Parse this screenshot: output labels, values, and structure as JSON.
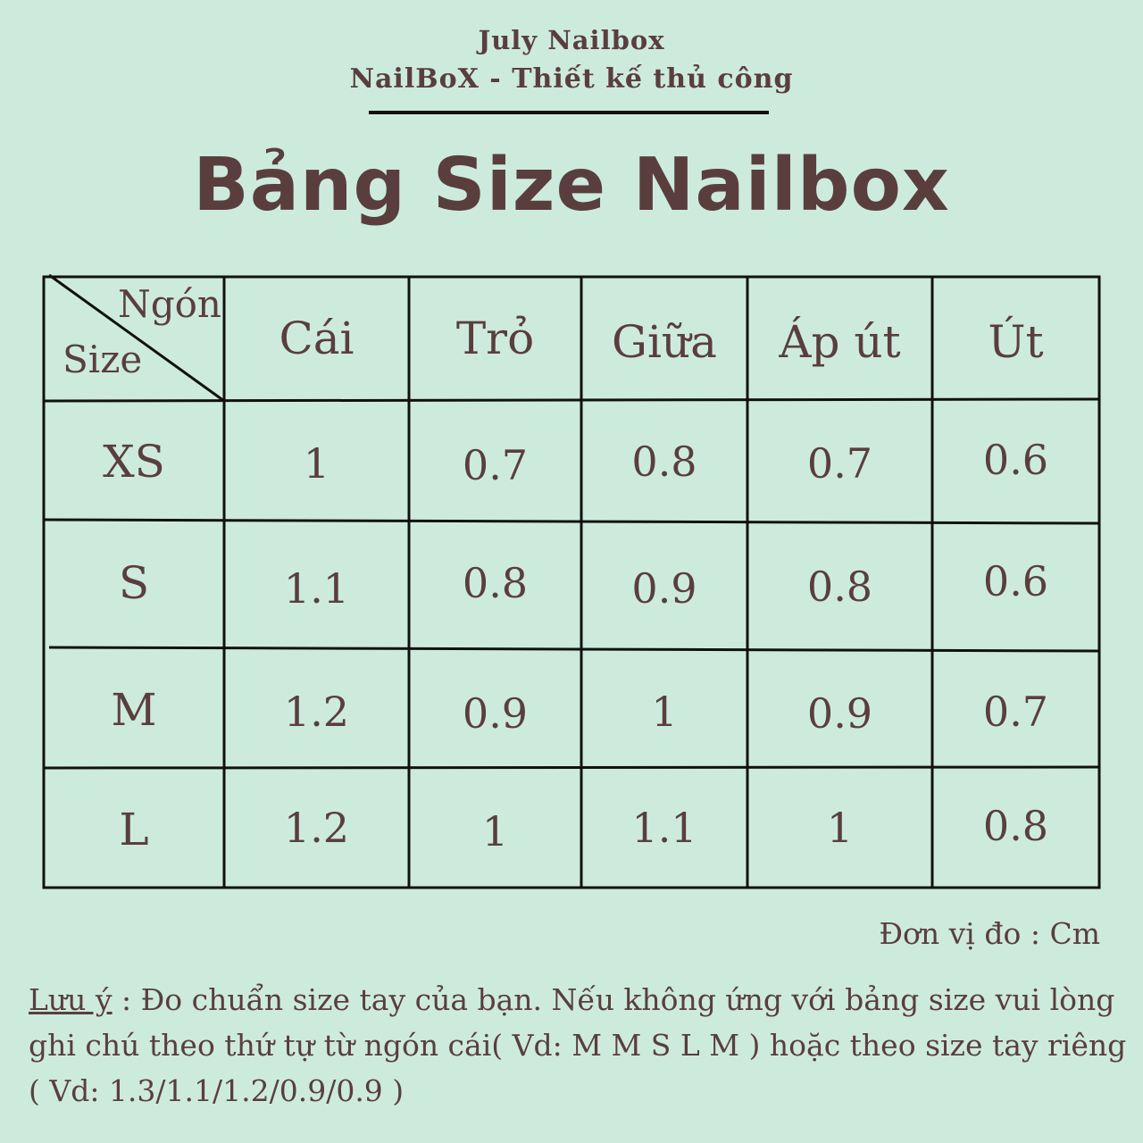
{
  "header": {
    "brand_name": "July Nailbox",
    "tagline": "NailBoX - Thiết kế thủ công"
  },
  "title": "Bảng Size Nailbox",
  "table": {
    "corner_top": "Ngón",
    "corner_bottom": "Size",
    "columns": [
      "Cái",
      "Trỏ",
      "Giữa",
      "Áp út",
      "Út"
    ],
    "rows": [
      {
        "label": "XS",
        "values": [
          "1",
          "0.7",
          "0.8",
          "0.7",
          "0.6"
        ]
      },
      {
        "label": "S",
        "values": [
          "1.1",
          "0.8",
          "0.9",
          "0.8",
          "0.6"
        ]
      },
      {
        "label": "M",
        "values": [
          "1.2",
          "0.9",
          "1",
          "0.9",
          "0.7"
        ]
      },
      {
        "label": "L",
        "values": [
          "1.2",
          "1",
          "1.1",
          "1",
          "0.8"
        ]
      }
    ]
  },
  "unit": "Đơn vị đo : Cm",
  "note": {
    "label": "Lưu ý",
    "separator": " : ",
    "text": "Đo chuẩn size tay của bạn. Nếu không ứng với bảng size vui lòng ghi chú theo thứ tự từ ngón cái( Vd: M M S L M ) hoặc theo size tay riêng ( Vd: 1.3/1.1/1.2/0.9/0.9 )"
  }
}
